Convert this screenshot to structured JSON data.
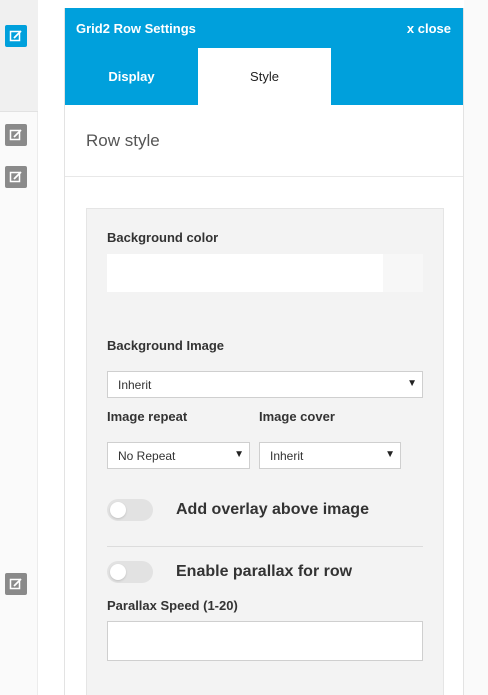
{
  "panel": {
    "title": "Grid2 Row Settings",
    "close_label": "x close"
  },
  "tabs": [
    {
      "label": "Display",
      "active": false
    },
    {
      "label": "Style",
      "active": true
    }
  ],
  "section": {
    "title": "Row style"
  },
  "fields": {
    "background_color": {
      "label": "Background color",
      "value": ""
    },
    "background_image": {
      "label": "Background Image",
      "value": "Inherit"
    },
    "image_repeat": {
      "label": "Image repeat",
      "value": "No Repeat"
    },
    "image_cover": {
      "label": "Image cover",
      "value": "Inherit"
    },
    "overlay": {
      "label": "Add overlay above image",
      "enabled": false
    },
    "parallax": {
      "label": "Enable parallax for row",
      "enabled": false
    },
    "parallax_speed": {
      "label": "Parallax Speed (1-20)",
      "value": ""
    }
  },
  "colors": {
    "accent": "#00a0dc",
    "rail_button": "#8a8a8a"
  },
  "icons": {
    "rail": "edit-icon",
    "select": "caret-down-icon"
  }
}
